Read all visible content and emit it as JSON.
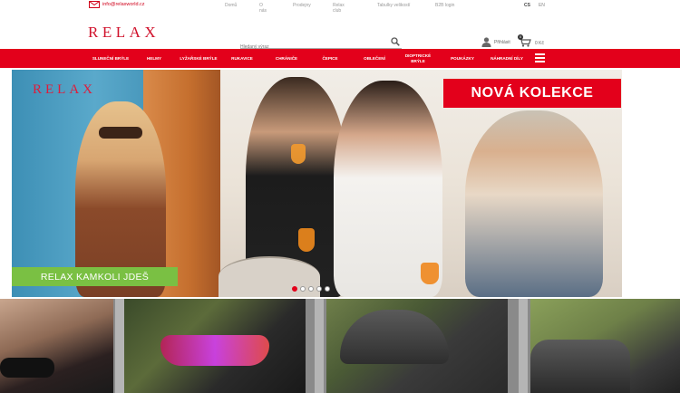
{
  "topbar": {
    "email": "info@relaxworld.cz",
    "links": [
      "Domů",
      "O nás",
      "Prodejny",
      "Relax club",
      "Tabulky velikostí",
      "B2B login"
    ],
    "languages": [
      {
        "code": "CS",
        "active": true
      },
      {
        "code": "EN",
        "active": false
      }
    ]
  },
  "header": {
    "logo": "RELAX",
    "search_placeholder": "Hledaný výraz",
    "account_label": "Přihlásit",
    "cart_total": "0 Kč",
    "cart_count": "0"
  },
  "nav": {
    "items": [
      "SLUNEČNÍ BRÝLE",
      "HELMY",
      "LYŽAŘSKÉ BRÝLE",
      "RUKAVICE",
      "CHRÁNIČE",
      "ČEPICE",
      "OBLEČENÍ",
      "DIOPTRICKÉ BRÝLE",
      "POUKÁZKY",
      "NÁHRADNÍ DÍLY"
    ]
  },
  "hero": {
    "logo": "RELAX",
    "headline": "NOVÁ KOLEKCE",
    "tagline": "RELAX KAMKOLI JDEŠ",
    "slide_count": 5,
    "active_slide": 1
  },
  "colors": {
    "brand_red": "#e3001b",
    "tagline_green": "#7ac043"
  }
}
